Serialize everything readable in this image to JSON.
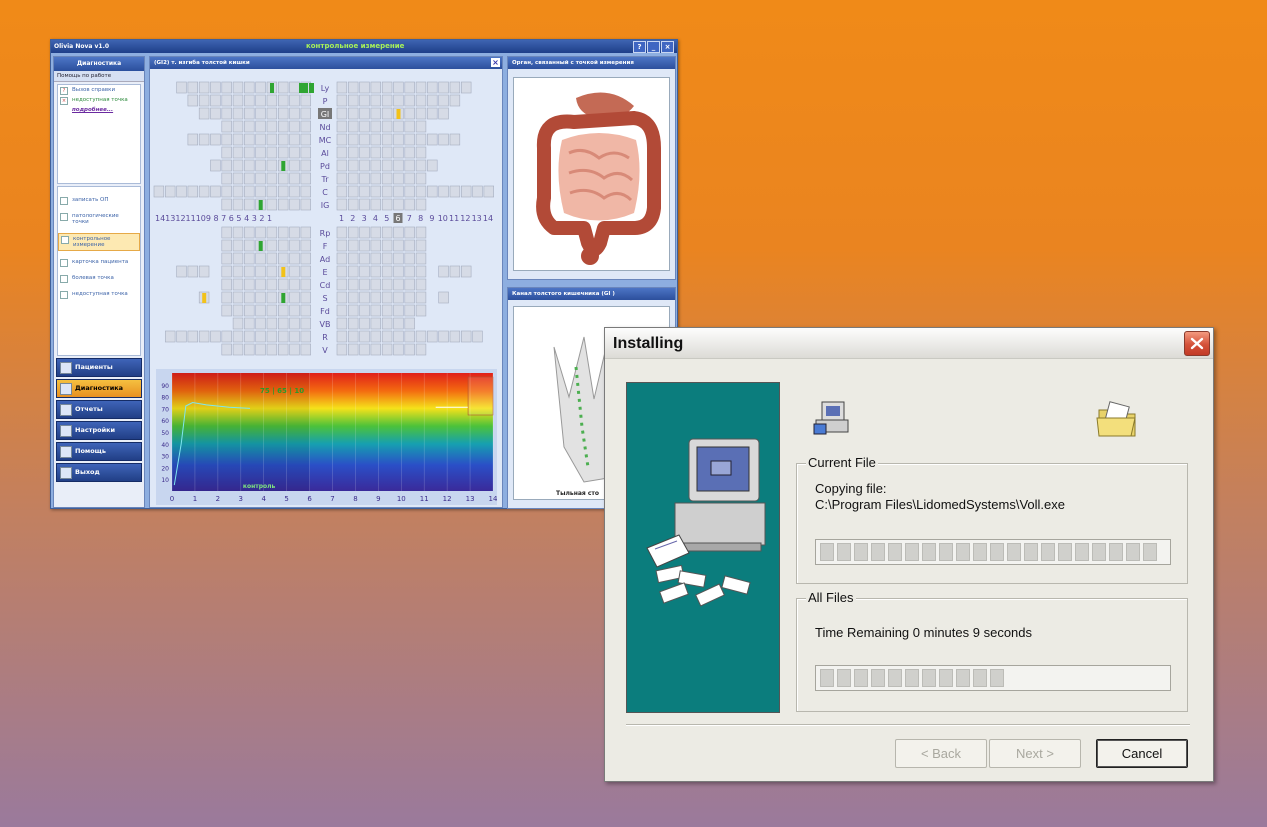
{
  "app": {
    "title": "Olivia Nova v1.0",
    "center_title": "контрольное измерение",
    "sidebar": {
      "header": "Диагностика",
      "help_header": "Помощь по работе",
      "help_call": "Вызов справки",
      "unavailable_point": "недоступная точка",
      "more_link": "подробнее...",
      "items": [
        {
          "label": "записать ОП"
        },
        {
          "label": "патологические точки"
        },
        {
          "label": "контрольное измерение"
        },
        {
          "label": "карточка пациента"
        },
        {
          "label": "болевая точка"
        },
        {
          "label": "недоступная точка"
        }
      ],
      "nav": [
        {
          "label": "Пациенты"
        },
        {
          "label": "Диагностика"
        },
        {
          "label": "Отчеты"
        },
        {
          "label": "Настройки"
        },
        {
          "label": "Помощь"
        },
        {
          "label": "Выход"
        }
      ]
    },
    "grid_panel": {
      "title": "(GI2) т. изгиба толстой кишки",
      "top_labels": [
        "Ly",
        "P",
        "GI",
        "Nd",
        "MC",
        "Al",
        "Pd",
        "Tr",
        "C",
        "IG"
      ],
      "bottom_labels": [
        "Rp",
        "F",
        "Ad",
        "E",
        "Cd",
        "S",
        "Fd",
        "VB",
        "R",
        "V"
      ],
      "left_numbers": "14131211109 8 7 6 5 4 3 2 1",
      "right_numbers": [
        "1",
        "2",
        "3",
        "4",
        "5",
        "6",
        "7",
        "8",
        "9",
        "10",
        "11",
        "12",
        "13",
        "14"
      ],
      "selected_number": "6"
    },
    "measure_chart": {
      "readout": "75 | 65 | 10",
      "caption": "контроль",
      "y_ticks": [
        "90",
        "80",
        "70",
        "60",
        "50",
        "40",
        "30",
        "20",
        "10"
      ],
      "x_ticks": [
        "0",
        "1",
        "2",
        "3",
        "4",
        "5",
        "6",
        "7",
        "8",
        "9",
        "10",
        "11",
        "12",
        "13",
        "14"
      ]
    },
    "organ_panel_title": "Орган, связанный с точкой измерения",
    "channel_panel_title": "Канал толстого кишечника (GI )",
    "channel_caption": "Тыльная сто"
  },
  "dialog": {
    "title": "Installing",
    "current_file_label": "Current File",
    "copying_label": "Copying file:",
    "file_path": "C:\\Program Files\\LidomedSystems\\Voll.exe",
    "current_progress": 0,
    "all_files_label": "All Files",
    "time_remaining": "Time Remaining 0 minutes 9 seconds",
    "all_progress": 0.54,
    "back_label": "< Back",
    "next_label": "Next >",
    "cancel_label": "Cancel"
  }
}
